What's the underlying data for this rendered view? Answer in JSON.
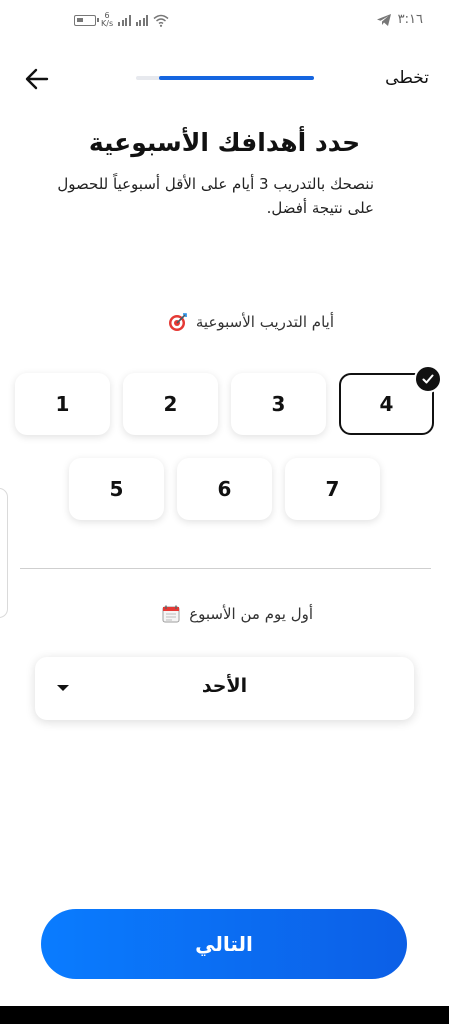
{
  "status_bar": {
    "time": "٣:١٦",
    "net_speed_value": "6",
    "net_speed_unit": "K/s"
  },
  "header": {
    "skip_label": "تخطى",
    "progress_fraction": 0.87
  },
  "title": "حدد أهدافك الأسبوعية",
  "subtitle": "ننصحك بالتدريب 3 أيام على الأقل أسبوعياً للحصول على نتيجة أفضل.",
  "training_days": {
    "label": "أيام التدريب الأسبوعية",
    "options": [
      "1",
      "2",
      "3",
      "4",
      "5",
      "6",
      "7"
    ],
    "selected": "4"
  },
  "first_day": {
    "label": "أول يوم من الأسبوع",
    "selected_value": "الأحد"
  },
  "next_button_label": "التالي",
  "colors": {
    "primary": "#0a7cff",
    "progress": "#1565e0"
  }
}
